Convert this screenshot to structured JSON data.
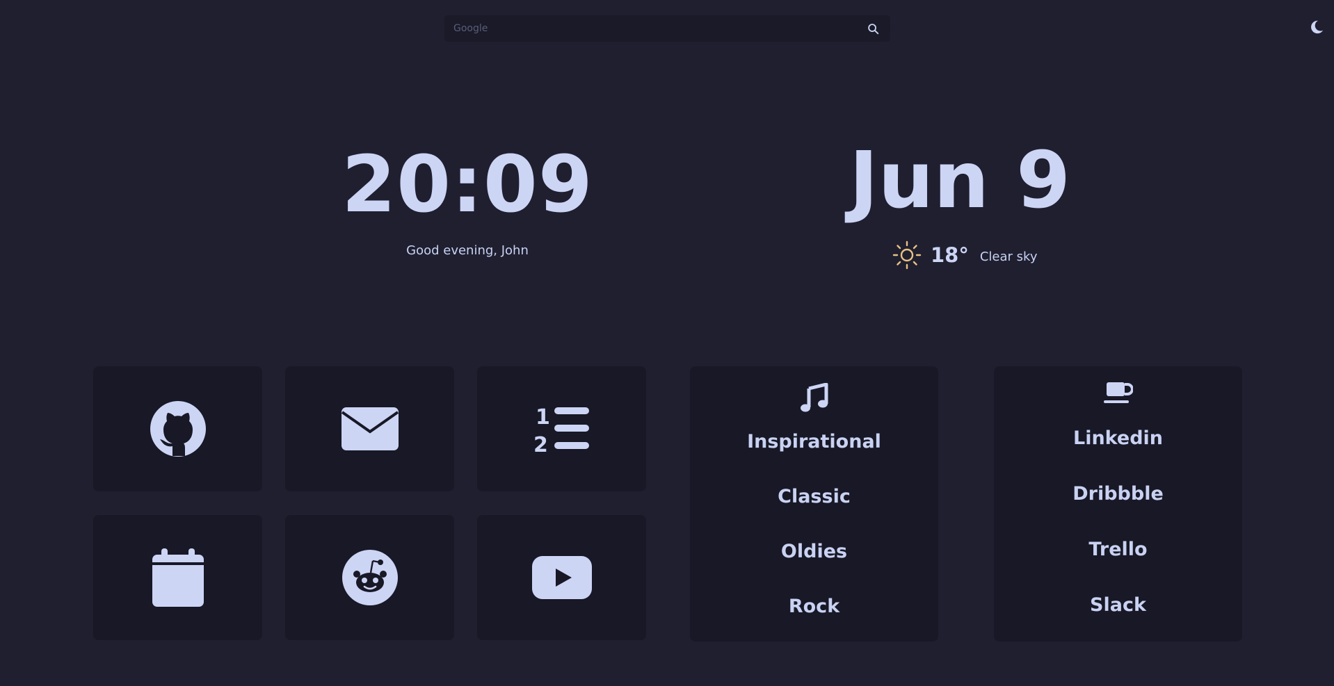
{
  "search": {
    "placeholder": "Google",
    "value": ""
  },
  "theme_toggle": {
    "icon": "moon-icon"
  },
  "clock": {
    "time": "20:09",
    "greeting": "Good evening, John"
  },
  "date": {
    "text": "Jun 9"
  },
  "weather": {
    "icon": "sun-icon",
    "temperature": "18°",
    "description": "Clear sky"
  },
  "tiles": [
    {
      "icon": "github-icon"
    },
    {
      "icon": "mail-icon"
    },
    {
      "icon": "numbered-list-icon"
    },
    {
      "icon": "calendar-icon"
    },
    {
      "icon": "reddit-icon"
    },
    {
      "icon": "youtube-icon"
    }
  ],
  "music_card": {
    "icon": "music-note-icon",
    "links": [
      "Inspirational",
      "Classic",
      "Oldies",
      "Rock"
    ]
  },
  "work_card": {
    "icon": "coffee-cup-icon",
    "links": [
      "Linkedin",
      "Dribbble",
      "Trello",
      "Slack"
    ]
  },
  "colors": {
    "background": "#1f1f30",
    "card": "#181826",
    "foreground": "#cdd5f5",
    "sun": "#e7c283"
  }
}
